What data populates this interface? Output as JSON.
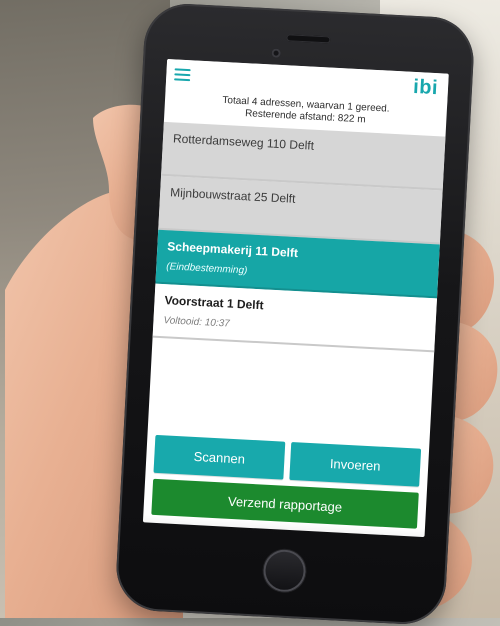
{
  "app": {
    "logo_text": "ibi",
    "menu_icon": "hamburger-icon"
  },
  "summary": {
    "line1": "Totaal 4 adressen, waarvan 1 gereed.",
    "line2": "Resterende afstand: 822 m"
  },
  "addresses": [
    {
      "title": "Rotterdamseweg 110 Delft",
      "subtitle": "",
      "style": "gray"
    },
    {
      "title": "Mijnbouwstraat 25 Delft",
      "subtitle": "",
      "style": "gray"
    },
    {
      "title": "Scheepmakerij 11 Delft",
      "subtitle": "(Eindbestemming)",
      "style": "teal"
    },
    {
      "title": "Voorstraat 1 Delft",
      "subtitle": "Voltooid: 10:37",
      "style": "white"
    }
  ],
  "buttons": {
    "scan": "Scannen",
    "enter": "Invoeren",
    "send": "Verzend rapportage"
  },
  "colors": {
    "accent": "#18a9ac",
    "selected_row": "#16a6a6",
    "success": "#1c8a2e",
    "inactive_row": "#d6d6d6"
  }
}
